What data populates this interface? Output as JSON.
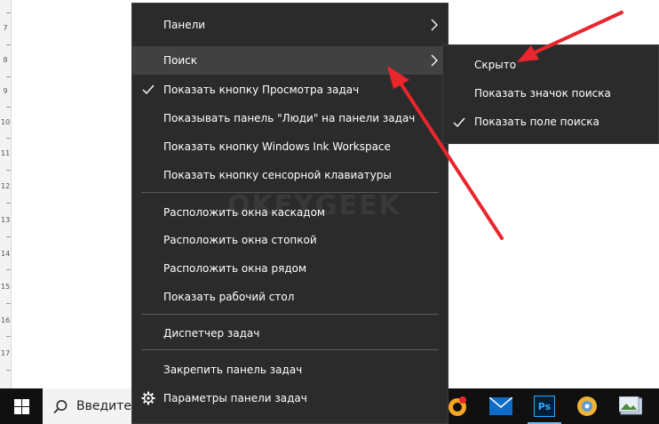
{
  "ruler": {
    "numbers": [
      "7",
      "8",
      "9",
      "10",
      "11",
      "12",
      "13",
      "14",
      "15",
      "16",
      "17"
    ]
  },
  "context_menu": {
    "items": [
      {
        "label": "Панели",
        "has_submenu": true
      },
      {
        "label": "Поиск",
        "has_submenu": true,
        "highlighted": true
      },
      {
        "label": "Показать кнопку Просмотра задач",
        "checked": true
      },
      {
        "label": "Показывать панель \"Люди\" на панели задач"
      },
      {
        "label": "Показать кнопку Windows Ink Workspace"
      },
      {
        "label": "Показать кнопку сенсорной клавиатуры"
      },
      {
        "label": "Расположить окна каскадом"
      },
      {
        "label": "Расположить окна стопкой"
      },
      {
        "label": "Расположить окна рядом"
      },
      {
        "label": "Показать рабочий стол"
      },
      {
        "label": "Диспетчер задач"
      },
      {
        "label": "Закрепить панель задач"
      },
      {
        "label": "Параметры панели задач",
        "icon": "gear-icon"
      }
    ]
  },
  "submenu": {
    "items": [
      {
        "label": "Скрыто"
      },
      {
        "label": "Показать значок поиска"
      },
      {
        "label": "Показать поле поиска",
        "checked": true
      }
    ]
  },
  "watermark": "OKEYGEEK",
  "taskbar": {
    "search_text": "Введите",
    "start_icon": "windows-logo-icon",
    "search_icon": "search-icon",
    "pinned_icons": [
      "music-app-icon",
      "mail-icon",
      "photoshop-icon",
      "xnview-icon",
      "photos-icon"
    ],
    "photoshop_label": "Ps"
  },
  "colors": {
    "menu_bg": "#2b2b2b",
    "menu_highlight": "#414141",
    "annotation_arrow": "#e8262c",
    "taskbar_bg": "#101010"
  }
}
